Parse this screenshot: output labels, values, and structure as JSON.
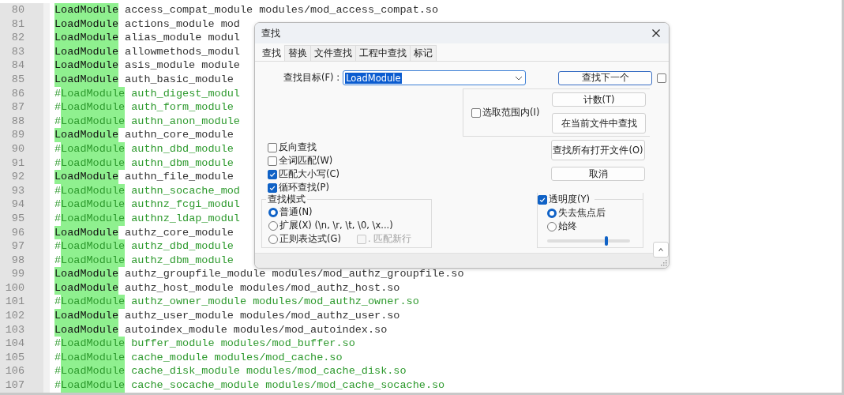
{
  "editor": {
    "lines": [
      {
        "num": "80",
        "commented": false,
        "keyword": "LoadModule",
        "rest": "access_compat_module modules/mod_access_compat.so"
      },
      {
        "num": "81",
        "commented": false,
        "keyword": "LoadModule",
        "rest": "actions_module mod"
      },
      {
        "num": "82",
        "commented": false,
        "keyword": "LoadModule",
        "rest": "alias_module modul"
      },
      {
        "num": "83",
        "commented": false,
        "keyword": "LoadModule",
        "rest": "allowmethods_modul"
      },
      {
        "num": "84",
        "commented": false,
        "keyword": "LoadModule",
        "rest": "asis_module module"
      },
      {
        "num": "85",
        "commented": false,
        "keyword": "LoadModule",
        "rest": "auth_basic_module"
      },
      {
        "num": "86",
        "commented": true,
        "comment": "#",
        "keyword": "LoadModule",
        "rest": "auth_digest_modul"
      },
      {
        "num": "87",
        "commented": true,
        "comment": "#",
        "keyword": "LoadModule",
        "rest": "auth_form_module"
      },
      {
        "num": "88",
        "commented": true,
        "comment": "#",
        "keyword": "LoadModule",
        "rest": "authn_anon_module"
      },
      {
        "num": "89",
        "commented": false,
        "keyword": "LoadModule",
        "rest": "authn_core_module"
      },
      {
        "num": "90",
        "commented": true,
        "comment": "#",
        "keyword": "LoadModule",
        "rest": "authn_dbd_module"
      },
      {
        "num": "91",
        "commented": true,
        "comment": "#",
        "keyword": "LoadModule",
        "rest": "authn_dbm_module"
      },
      {
        "num": "92",
        "commented": false,
        "keyword": "LoadModule",
        "rest": "authn_file_module"
      },
      {
        "num": "93",
        "commented": true,
        "comment": "#",
        "keyword": "LoadModule",
        "rest": "authn_socache_mod"
      },
      {
        "num": "94",
        "commented": true,
        "comment": "#",
        "keyword": "LoadModule",
        "rest": "authnz_fcgi_modul"
      },
      {
        "num": "95",
        "commented": true,
        "comment": "#",
        "keyword": "LoadModule",
        "rest": "authnz_ldap_modul"
      },
      {
        "num": "96",
        "commented": false,
        "keyword": "LoadModule",
        "rest": "authz_core_module"
      },
      {
        "num": "97",
        "commented": true,
        "comment": "#",
        "keyword": "LoadModule",
        "rest": "authz_dbd_module"
      },
      {
        "num": "98",
        "commented": true,
        "comment": "#",
        "keyword": "LoadModule",
        "rest": "authz_dbm_module"
      },
      {
        "num": "99",
        "commented": false,
        "keyword": "LoadModule",
        "rest": "authz_groupfile_module modules/mod_authz_groupfile.so"
      },
      {
        "num": "100",
        "commented": false,
        "keyword": "LoadModule",
        "rest": "authz_host_module modules/mod_authz_host.so"
      },
      {
        "num": "101",
        "commented": true,
        "comment": "#",
        "keyword": "LoadModule",
        "rest": "authz_owner_module modules/mod_authz_owner.so"
      },
      {
        "num": "102",
        "commented": false,
        "keyword": "LoadModule",
        "rest": "authz_user_module modules/mod_authz_user.so"
      },
      {
        "num": "103",
        "commented": false,
        "keyword": "LoadModule",
        "rest": "autoindex_module modules/mod_autoindex.so"
      },
      {
        "num": "104",
        "commented": true,
        "comment": "#",
        "keyword": "LoadModule",
        "rest": "buffer_module modules/mod_buffer.so"
      },
      {
        "num": "105",
        "commented": true,
        "comment": "#",
        "keyword": "LoadModule",
        "rest": "cache_module modules/mod_cache.so"
      },
      {
        "num": "106",
        "commented": true,
        "comment": "#",
        "keyword": "LoadModule",
        "rest": "cache_disk_module modules/mod_cache_disk.so"
      },
      {
        "num": "107",
        "commented": true,
        "comment": "#",
        "keyword": "LoadModule",
        "rest": "cache_socache_module modules/mod_cache_socache.so"
      }
    ]
  },
  "dialog": {
    "title": "查找",
    "tabs": [
      {
        "label": "查找",
        "selected": true
      },
      {
        "label": "替换",
        "selected": false
      },
      {
        "label": "文件查找",
        "selected": false
      },
      {
        "label": "工程中查找",
        "selected": false
      },
      {
        "label": "标记",
        "selected": false
      }
    ],
    "find_field": {
      "label": "查找目标(F) :",
      "value": "LoadModule",
      "text_selected": true
    },
    "find_next_button": "查找下一个",
    "side_checkbox": {
      "checked": false
    },
    "in_selection": {
      "label": "选取范围内(I)",
      "checked": false
    },
    "count_button": "计数(T)",
    "find_in_current_button": "在当前文件中查找",
    "options": [
      {
        "label": "反向查找",
        "checked": false
      },
      {
        "label": "全词匹配(W)",
        "checked": false
      },
      {
        "label": "匹配大小写(C)",
        "checked": true
      },
      {
        "label": "循环查找(P)",
        "checked": true
      }
    ],
    "search_mode": {
      "title": "查找模式",
      "modes": [
        {
          "label": "普通(N)",
          "selected": true
        },
        {
          "label": "扩展(X) (\\n, \\r, \\t, \\0, \\x...)",
          "selected": false
        },
        {
          "label": "正则表达式(G)",
          "selected": false
        }
      ],
      "dot_newline": {
        "label": ". 匹配新行",
        "checked": false,
        "disabled": true
      }
    },
    "find_all_open_button": "查找所有打开文件(O)",
    "cancel_button": "取消",
    "transparency": {
      "label": "透明度(Y)",
      "checked": true,
      "modes": [
        {
          "label": "失去焦点后",
          "selected": true
        },
        {
          "label": "始终",
          "selected": false
        }
      ],
      "level": 0.72
    }
  }
}
